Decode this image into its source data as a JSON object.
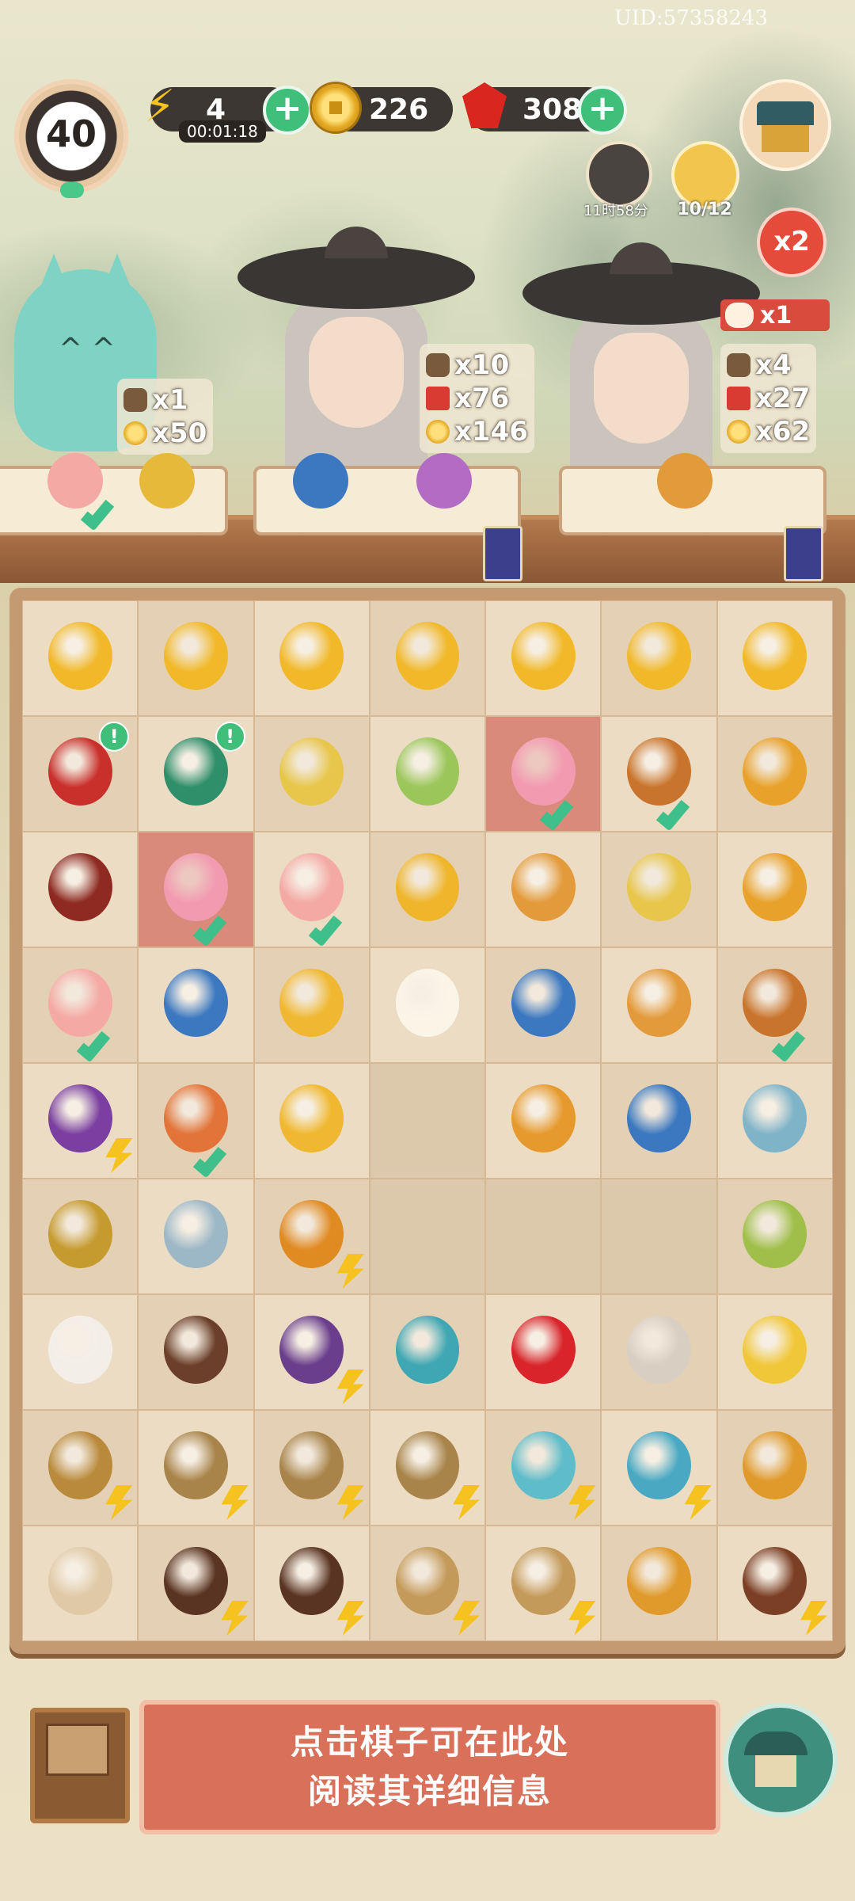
{
  "uid": "UID:57358243",
  "hud": {
    "level": "40",
    "energy": "4",
    "energy_timer": "00:01:18",
    "coins": "226",
    "gems": "308"
  },
  "events": {
    "pot_timer": "11时58分",
    "cat_progress": "10/12",
    "multiplier": "x2"
  },
  "customers": [
    {
      "name": "spirit-cat",
      "requests": [
        {
          "icon": "spoon",
          "amount": "x1"
        },
        {
          "icon": "coin",
          "amount": "x50"
        }
      ]
    },
    {
      "name": "swordsman-1",
      "requests": [
        {
          "icon": "spoon",
          "amount": "x10"
        },
        {
          "icon": "ticket",
          "amount": "x76"
        },
        {
          "icon": "coin",
          "amount": "x146"
        }
      ]
    },
    {
      "name": "swordsman-2",
      "cat_bonus": "x1",
      "requests": [
        {
          "icon": "spoon",
          "amount": "x4"
        },
        {
          "icon": "ticket",
          "amount": "x27"
        },
        {
          "icon": "coin",
          "amount": "x62"
        }
      ]
    }
  ],
  "board": {
    "rows": [
      [
        "coin-pile",
        "coin-pile",
        "coin-pile",
        "coin-pile",
        "coin-pile",
        "coin-pile",
        "coin-pile"
      ],
      [
        "red-tin",
        "green-tin",
        "fried-rice-bowl",
        "tea-soup-bowl",
        "flower-cake",
        "chicken-rice-bowl",
        "roast-chicken"
      ],
      [
        "red-bean-soup",
        "flower-cake",
        "pink-bun",
        "coin-stack",
        "egg-fried-rice",
        "fried-rice-bowl",
        "roast-chicken"
      ],
      [
        "pink-bun",
        "tea-cup",
        "coin-pair",
        "fried-egg",
        "tea-cup",
        "egg-fried-rice",
        "chicken-rice-bowl"
      ],
      [
        "scroll-box",
        "lantern",
        "coin-pair",
        "",
        "porcelain-bowl",
        "tea-cup",
        "jade-pendant"
      ],
      [
        "leaf-pile",
        "feather",
        "energy-jar",
        "",
        "",
        "",
        "bamboo-slip"
      ],
      [
        "cotton-bowl",
        "wood-box",
        "loom",
        "jade-pot",
        "ruby",
        "silk-spool",
        "bird"
      ],
      [
        "rice-basket",
        "fruit-basket",
        "fruit-basket",
        "fruit-basket",
        "teapot-stand",
        "teapot",
        "hen-nest"
      ],
      [
        "egg-nest",
        "treasure-chest",
        "treasure-chest",
        "scroll-basket",
        "scroll-basket",
        "hen-nest",
        "tree-stump"
      ]
    ],
    "colors": {
      "coin-pile": "#f1b92a",
      "red-tin": "#c9302c",
      "green-tin": "#2f8f6a",
      "fried-rice-bowl": "#e7c64a",
      "tea-soup-bowl": "#9bc65a",
      "flower-cake": "#f29bb0",
      "chicken-rice-bowl": "#c9742c",
      "roast-chicken": "#e8a12a",
      "red-bean-soup": "#8e2a22",
      "pink-bun": "#f4a9a4",
      "coin-stack": "#efb52b",
      "egg-fried-rice": "#e39a3a",
      "tea-cup": "#3b78c0",
      "coin-pair": "#f0b830",
      "fried-egg": "#fbf5e8",
      "scroll-box": "#7a3fa0",
      "lantern": "#e2743a",
      "porcelain-bowl": "#e69a2e",
      "jade-pendant": "#7fb3c8",
      "leaf-pile": "#c59a2e",
      "feather": "#9cb7c6",
      "energy-jar": "#e08a22",
      "bamboo-slip": "#9fbf4a",
      "cotton-bowl": "#f3efe8",
      "wood-box": "#6b3f2a",
      "loom": "#6a3e8c",
      "jade-pot": "#3fa7b3",
      "ruby": "#d8242a",
      "silk-spool": "#d8cfc2",
      "bird": "#f1c73a",
      "rice-basket": "#b98a3c",
      "fruit-basket": "#a8844a",
      "teapot-stand": "#5fbcc9",
      "teapot": "#4aa9c2",
      "hen-nest": "#e09a2c",
      "egg-nest": "#e0c9a6",
      "treasure-chest": "#5a3422",
      "scroll-basket": "#c49a5a",
      "tree-stump": "#7b3f25"
    },
    "checks": [
      [
        1,
        4
      ],
      [
        1,
        5
      ],
      [
        2,
        1
      ],
      [
        2,
        2
      ],
      [
        3,
        0
      ],
      [
        3,
        6
      ],
      [
        4,
        1
      ]
    ],
    "bolts": [
      [
        4,
        0
      ],
      [
        5,
        2
      ],
      [
        6,
        2
      ],
      [
        7,
        0
      ],
      [
        7,
        1
      ],
      [
        7,
        2
      ],
      [
        7,
        3
      ],
      [
        7,
        4
      ],
      [
        7,
        5
      ],
      [
        8,
        1
      ],
      [
        8,
        2
      ],
      [
        8,
        3
      ],
      [
        8,
        4
      ],
      [
        8,
        6
      ]
    ],
    "exclaims": [
      [
        1,
        0
      ],
      [
        1,
        1
      ]
    ],
    "highlighted": [
      [
        1,
        4
      ],
      [
        2,
        1
      ]
    ]
  },
  "info_panel": {
    "line1": "点击棋子可在此处",
    "line2": "阅读其详细信息"
  }
}
